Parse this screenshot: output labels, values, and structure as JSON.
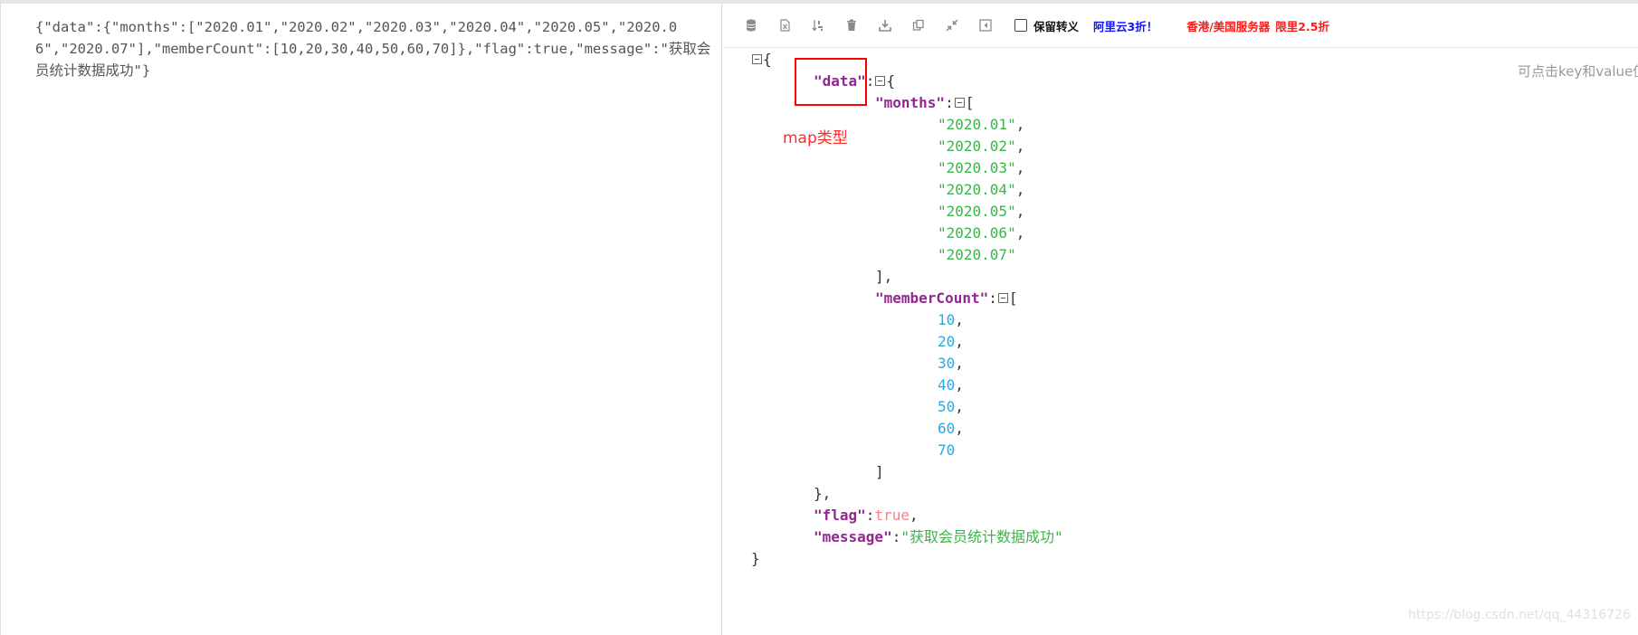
{
  "raw_json_text": "{\"data\":{\"months\":[\"2020.01\",\"2020.02\",\"2020.03\",\"2020.04\",\"2020.05\",\"2020.06\",\"2020.07\"],\"memberCount\":[10,20,30,40,50,60,70]},\"flag\":true,\"message\":\"获取会员统计数据成功\"}",
  "toolbar": {
    "icons": [
      "database-icon",
      "excel-icon",
      "sort-icon",
      "trash-icon",
      "download-icon",
      "copy-icon",
      "compress-icon",
      "collapse-icon"
    ],
    "keep_escape_label": "保留转义",
    "keep_escape_checked": false,
    "ad_aliyun": "阿里云3折！",
    "ad_server_part1": "香港/美国服务器",
    "ad_server_part2": "限里2.5折"
  },
  "hint_text": "可点击key和value值进行编辑",
  "annotation_text": "map类型",
  "watermark": "https://blog.csdn.net/qq_44316726",
  "tree": {
    "data_key": "\"data\"",
    "months_key": "\"months\"",
    "months": [
      "\"2020.01\"",
      "\"2020.02\"",
      "\"2020.03\"",
      "\"2020.04\"",
      "\"2020.05\"",
      "\"2020.06\"",
      "\"2020.07\""
    ],
    "memberCount_key": "\"memberCount\"",
    "memberCount": [
      "10",
      "20",
      "30",
      "40",
      "50",
      "60",
      "70"
    ],
    "flag_key": "\"flag\"",
    "flag_value": "true",
    "message_key": "\"message\"",
    "message_value": "\"获取会员统计数据成功\""
  }
}
